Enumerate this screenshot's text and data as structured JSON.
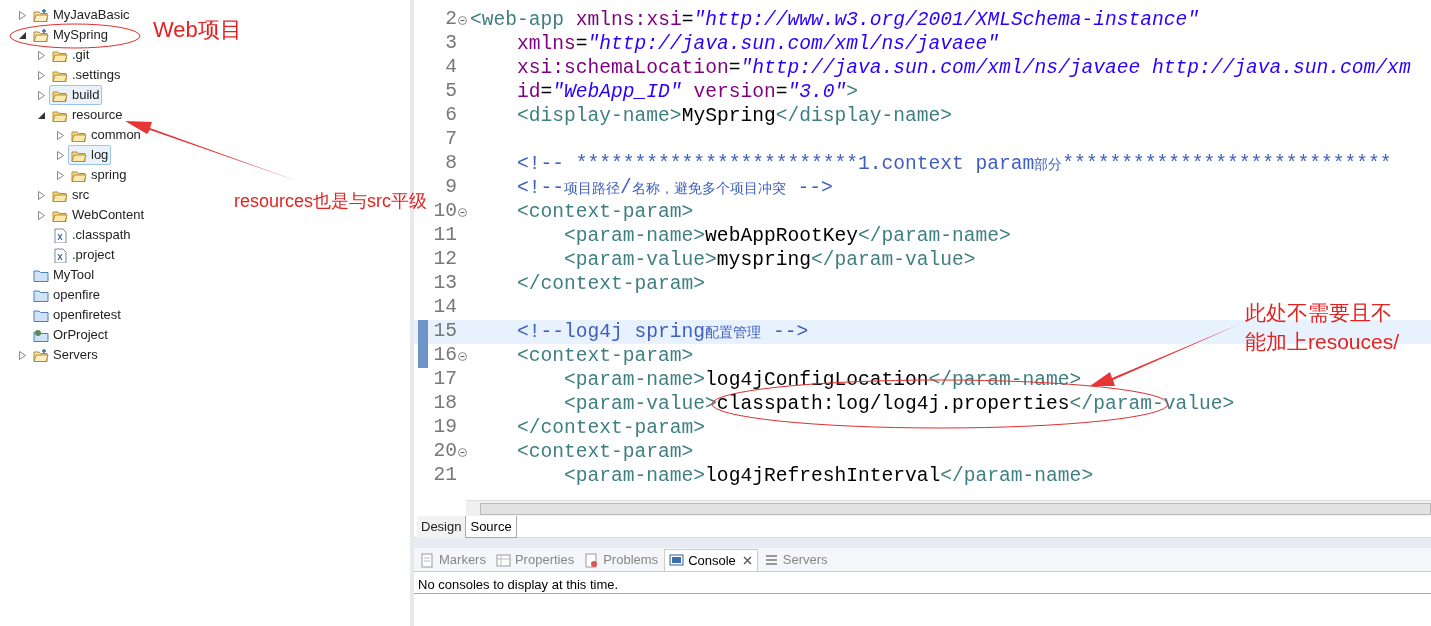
{
  "project_tree": [
    {
      "label": "MyJavaBasic",
      "kind": "java_project",
      "expanded": false,
      "selected": false
    },
    {
      "label": "MySpring",
      "kind": "java_project",
      "expanded": true,
      "selected": false,
      "children": [
        {
          "label": ".git",
          "kind": "folder",
          "expanded": false,
          "selected": false
        },
        {
          "label": ".settings",
          "kind": "folder",
          "expanded": false,
          "selected": false
        },
        {
          "label": "build",
          "kind": "folder",
          "expanded": false,
          "selected": true
        },
        {
          "label": "resource",
          "kind": "folder",
          "expanded": true,
          "selected": false,
          "children": [
            {
              "label": "common",
              "kind": "folder",
              "expanded": false,
              "selected": false
            },
            {
              "label": "log",
              "kind": "folder",
              "expanded": false,
              "selected": true
            },
            {
              "label": "spring",
              "kind": "folder",
              "expanded": false,
              "selected": false
            }
          ]
        },
        {
          "label": "src",
          "kind": "folder",
          "expanded": false,
          "selected": false
        },
        {
          "label": "WebContent",
          "kind": "folder",
          "expanded": false,
          "selected": false
        },
        {
          "label": ".classpath",
          "kind": "xml_file",
          "selected": false
        },
        {
          "label": ".project",
          "kind": "xml_file",
          "selected": false
        }
      ]
    },
    {
      "label": "MyTool",
      "kind": "closed_project",
      "selected": false
    },
    {
      "label": "openfire",
      "kind": "closed_project",
      "selected": false
    },
    {
      "label": "openfiretest",
      "kind": "closed_project",
      "selected": false
    },
    {
      "label": "OrProject",
      "kind": "server_project",
      "selected": false
    },
    {
      "label": "Servers",
      "kind": "java_project",
      "expanded": false,
      "selected": false
    }
  ],
  "editor": {
    "lines": [
      {
        "number": "2",
        "fold": true,
        "current": false,
        "segments": [
          {
            "kind": "open_tag",
            "text": "<web-app "
          },
          {
            "kind": "attr",
            "text": "xmlns:xsi"
          },
          {
            "kind": "plain",
            "text": "="
          },
          {
            "kind": "value",
            "text": "\"http://www.w3.org/2001/XMLSchema-instance\""
          }
        ]
      },
      {
        "number": "3",
        "fold": false,
        "current": false,
        "segments": [
          {
            "kind": "attr",
            "text": "xmlns"
          },
          {
            "kind": "plain",
            "text": "="
          },
          {
            "kind": "value",
            "text": "\"http://java.sun.com/xml/ns/javaee\""
          }
        ]
      },
      {
        "number": "4",
        "fold": false,
        "current": false,
        "segments": [
          {
            "kind": "attr",
            "text": "xsi:schemaLocation"
          },
          {
            "kind": "plain",
            "text": "="
          },
          {
            "kind": "value",
            "text": "\"http://java.sun.com/xml/ns/javaee http://java.sun.com/xm"
          }
        ]
      },
      {
        "number": "5",
        "fold": false,
        "current": false,
        "segments": [
          {
            "kind": "attr",
            "text": "id"
          },
          {
            "kind": "plain",
            "text": "="
          },
          {
            "kind": "value",
            "text": "\"WebApp_ID\""
          },
          {
            "kind": "attr",
            "text": " version"
          },
          {
            "kind": "plain",
            "text": "="
          },
          {
            "kind": "value",
            "text": "\"3.0\""
          },
          {
            "kind": "tag",
            "text": ">"
          }
        ]
      },
      {
        "number": "6",
        "fold": false,
        "current": false,
        "segments": [
          {
            "kind": "open_tag",
            "text": "<display-name>"
          },
          {
            "kind": "plain",
            "text": "MySpring"
          },
          {
            "kind": "close_tag",
            "text": "</display-name>"
          }
        ]
      },
      {
        "number": "7",
        "fold": false,
        "current": false
      },
      {
        "number": "8",
        "fold": false,
        "current": false,
        "segments": [
          {
            "kind": "comment",
            "text": "<!-- ************************1.context param部分****************************"
          }
        ]
      },
      {
        "number": "9",
        "fold": false,
        "current": false,
        "segments": [
          {
            "kind": "comment",
            "text": "<!--项目路径/名称，避免多个项目冲突 -->"
          }
        ]
      },
      {
        "number": "10",
        "fold": true,
        "current": false,
        "segments": [
          {
            "kind": "open_tag",
            "text": "<context-param>"
          }
        ]
      },
      {
        "number": "11",
        "fold": false,
        "current": false,
        "segments": [
          {
            "kind": "open_tag",
            "text": "<param-name>"
          },
          {
            "kind": "plain",
            "text": "webAppRootKey"
          },
          {
            "kind": "close_tag",
            "text": "</param-name>"
          }
        ]
      },
      {
        "number": "12",
        "fold": false,
        "current": false,
        "segments": [
          {
            "kind": "open_tag",
            "text": "<param-value>"
          },
          {
            "kind": "plain",
            "text": "myspring"
          },
          {
            "kind": "close_tag",
            "text": "</param-value>"
          }
        ]
      },
      {
        "number": "13",
        "fold": false,
        "current": false,
        "segments": [
          {
            "kind": "close_tag",
            "text": "</context-param>"
          }
        ]
      },
      {
        "number": "14",
        "fold": false,
        "current": false
      },
      {
        "number": "15",
        "fold": false,
        "current": true,
        "segments": [
          {
            "kind": "comment",
            "text": "<!--log4j spring配置管理 -->"
          }
        ]
      },
      {
        "number": "16",
        "fold": true,
        "current": false,
        "segments": [
          {
            "kind": "open_tag",
            "text": "<context-param>"
          }
        ]
      },
      {
        "number": "17",
        "fold": false,
        "current": false,
        "segments": [
          {
            "kind": "open_tag",
            "text": "<param-name>"
          },
          {
            "kind": "plain",
            "text": "log4jConfigLocation"
          },
          {
            "kind": "close_tag",
            "text": "</param-name>"
          }
        ]
      },
      {
        "number": "18",
        "fold": false,
        "current": false,
        "segments": [
          {
            "kind": "open_tag",
            "text": "<param-value>"
          },
          {
            "kind": "plain",
            "text": "classpath:log/log4j.properties"
          },
          {
            "kind": "close_tag",
            "text": "</param-value>"
          }
        ]
      },
      {
        "number": "19",
        "fold": false,
        "current": false,
        "segments": [
          {
            "kind": "close_tag",
            "text": "</context-param>"
          }
        ]
      },
      {
        "number": "20",
        "fold": true,
        "current": false,
        "segments": [
          {
            "kind": "open_tag",
            "text": "<context-param>"
          }
        ]
      },
      {
        "number": "21",
        "fold": false,
        "current": false,
        "segments": [
          {
            "kind": "open_tag",
            "text": "<param-name>"
          },
          {
            "kind": "plain",
            "text": "log4jRefreshInterval"
          },
          {
            "kind": "close_tag",
            "text": "</param-name>"
          }
        ]
      }
    ],
    "tabs": [
      {
        "label": "Design",
        "selected": false
      },
      {
        "label": "Source",
        "selected": true
      }
    ]
  },
  "bottom_panel": {
    "tabs": [
      {
        "label": "Markers",
        "selected": false
      },
      {
        "label": "Properties",
        "selected": false
      },
      {
        "label": "Problems",
        "selected": false
      },
      {
        "label": "Console",
        "selected": true
      },
      {
        "label": "Servers",
        "selected": false
      }
    ],
    "message": "No consoles to display at this time."
  },
  "annotations": [
    "Web项目",
    "resources也是与src平级",
    "此处不需要且不能加上resouces/"
  ]
}
